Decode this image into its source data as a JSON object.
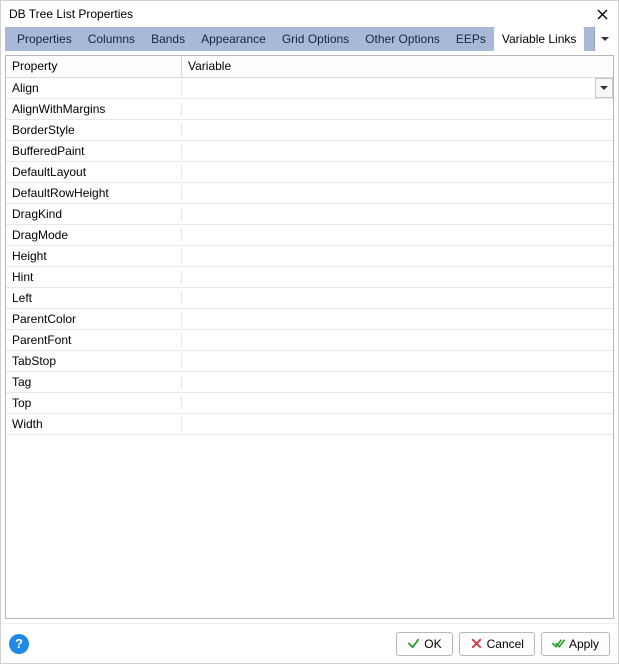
{
  "window": {
    "title": "DB Tree List Properties"
  },
  "tabs": [
    {
      "label": "Properties",
      "active": false
    },
    {
      "label": "Columns",
      "active": false
    },
    {
      "label": "Bands",
      "active": false
    },
    {
      "label": "Appearance",
      "active": false
    },
    {
      "label": "Grid Options",
      "active": false
    },
    {
      "label": "Other Options",
      "active": false
    },
    {
      "label": "EEPs",
      "active": false
    },
    {
      "label": "Variable Links",
      "active": true
    }
  ],
  "grid": {
    "columns": {
      "property": "Property",
      "variable": "Variable"
    },
    "rows": [
      {
        "property": "Align",
        "variable": "",
        "has_dropdown": true
      },
      {
        "property": "AlignWithMargins",
        "variable": ""
      },
      {
        "property": "BorderStyle",
        "variable": ""
      },
      {
        "property": "BufferedPaint",
        "variable": ""
      },
      {
        "property": "DefaultLayout",
        "variable": ""
      },
      {
        "property": "DefaultRowHeight",
        "variable": ""
      },
      {
        "property": "DragKind",
        "variable": ""
      },
      {
        "property": "DragMode",
        "variable": ""
      },
      {
        "property": "Height",
        "variable": ""
      },
      {
        "property": "Hint",
        "variable": ""
      },
      {
        "property": "Left",
        "variable": ""
      },
      {
        "property": "ParentColor",
        "variable": ""
      },
      {
        "property": "ParentFont",
        "variable": ""
      },
      {
        "property": "TabStop",
        "variable": ""
      },
      {
        "property": "Tag",
        "variable": ""
      },
      {
        "property": "Top",
        "variable": ""
      },
      {
        "property": "Width",
        "variable": ""
      }
    ]
  },
  "buttons": {
    "ok": "OK",
    "cancel": "Cancel",
    "apply": "Apply"
  },
  "help": "?"
}
